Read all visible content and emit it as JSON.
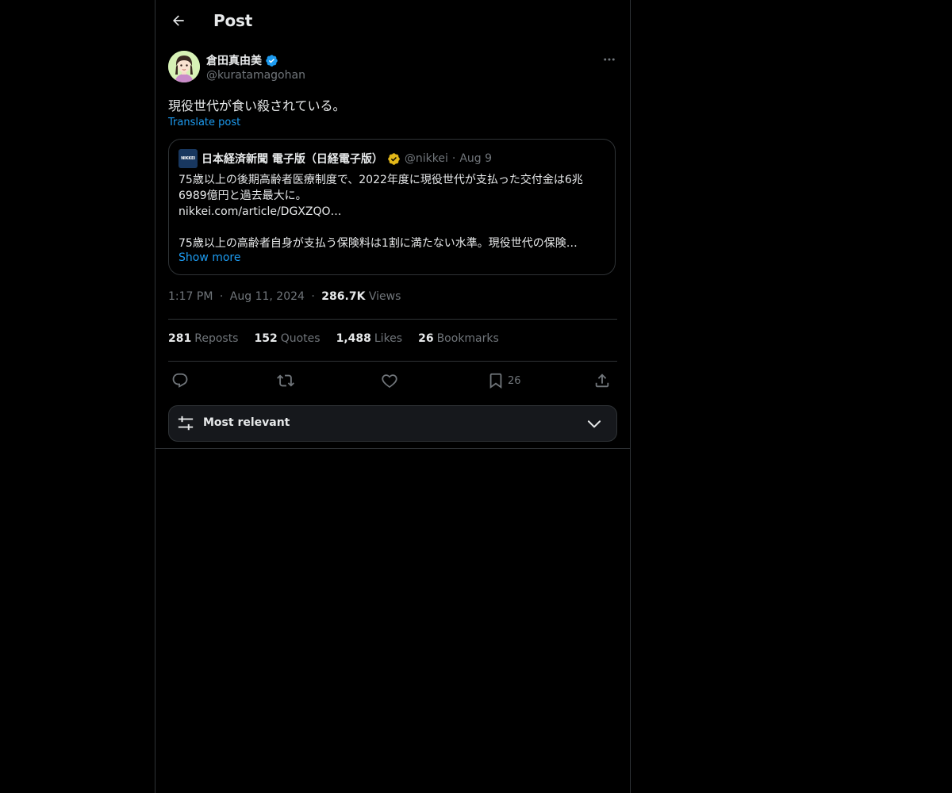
{
  "header": {
    "title": "Post",
    "back_icon": "arrow-left-icon"
  },
  "author": {
    "name": "倉田真由美",
    "handle": "@kuratamagohan",
    "verified": "blue-verified-badge",
    "avatar_icon": "avatar-illustration"
  },
  "post": {
    "text": "現役世代が食い殺されている。",
    "translate_label": "Translate post",
    "timestamp": "1:17 PM",
    "date": "Aug 11, 2024",
    "separator": "·",
    "views_count": "286.7K",
    "views_label": "Views"
  },
  "quote": {
    "logo_text": "NIKKEI",
    "name": "日本経済新聞 電子版（日経電子版）",
    "verified": "gold-verified-badge",
    "handle": "@nikkei",
    "separator": "·",
    "date": "Aug 9",
    "lines": [
      "75歳以上の後期高齢者医療制度で、2022年度に現役世代が支払った交付金は6兆",
      "6989億円と過去最大に。",
      "nikkei.com/article/DGXZQO…",
      "",
      "75歳以上の高齢者自身が支払う保険料は1割に満たない水準。現役世代の保険…"
    ],
    "show_more": "Show more"
  },
  "stats": [
    {
      "count": "281",
      "label": "Reposts"
    },
    {
      "count": "152",
      "label": "Quotes"
    },
    {
      "count": "1,488",
      "label": "Likes"
    },
    {
      "count": "26",
      "label": "Bookmarks"
    }
  ],
  "actions": {
    "reply_icon": "reply-icon",
    "repost_icon": "repost-icon",
    "like_icon": "heart-icon",
    "bookmark_icon": "bookmark-icon",
    "bookmark_count": "26",
    "share_icon": "share-icon"
  },
  "sort": {
    "label": "Most relevant",
    "icon": "sliders-icon"
  },
  "colors": {
    "background": "#000000",
    "text": "#e7e9ea",
    "muted": "#71767b",
    "accent": "#1d9bf0",
    "border": "#2f3336",
    "gold": "#e2b719"
  }
}
